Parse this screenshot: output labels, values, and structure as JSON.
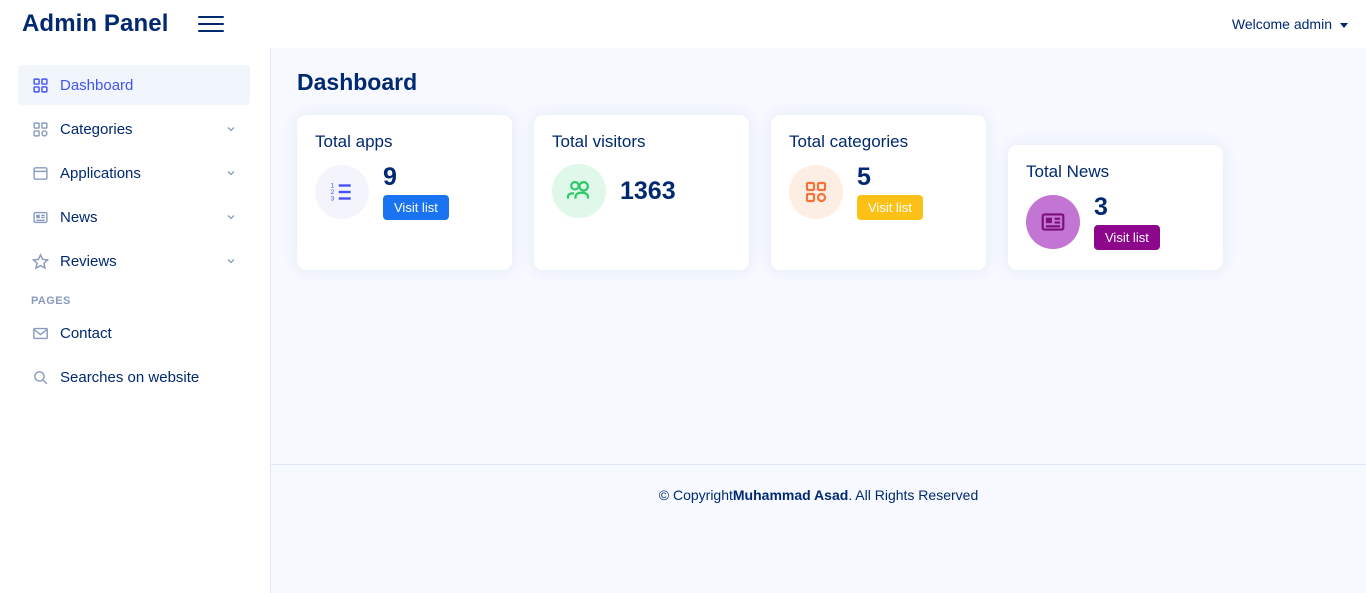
{
  "header": {
    "brand": "Admin Panel",
    "toggle_icon": "hamburger-menu-icon",
    "welcome_label": "Welcome admin",
    "caret_icon": "caret-down-icon"
  },
  "sidebar": {
    "items": [
      {
        "label": "Dashboard",
        "icon": "grid-icon",
        "active": true,
        "has_chevron": false
      },
      {
        "label": "Categories",
        "icon": "grid-icon",
        "active": false,
        "has_chevron": true
      },
      {
        "label": "Applications",
        "icon": "window-icon",
        "active": false,
        "has_chevron": true
      },
      {
        "label": "News",
        "icon": "news-icon",
        "active": false,
        "has_chevron": true
      },
      {
        "label": "Reviews",
        "icon": "star-icon",
        "active": false,
        "has_chevron": true
      }
    ],
    "section_heading": "PAGES",
    "page_items": [
      {
        "label": "Contact",
        "icon": "envelope-icon"
      },
      {
        "label": "Searches on website",
        "icon": "search-icon"
      }
    ]
  },
  "main": {
    "page_title": "Dashboard",
    "cards": [
      {
        "title": "Total apps",
        "value": "9",
        "icon": "numbered-list-icon",
        "icon_color": "#4154f1",
        "circle_color": "#f4f4fd",
        "button_label": "Visit list",
        "button_color": "#1a73f0",
        "has_button": true
      },
      {
        "title": "Total visitors",
        "value": "1363",
        "icon": "people-icon",
        "icon_color": "#2eca6a",
        "circle_color": "#e0f8e9",
        "button_label": "",
        "button_color": "",
        "has_button": false
      },
      {
        "title": "Total categories",
        "value": "5",
        "icon": "app-grid-icon",
        "icon_color": "#f3743b",
        "circle_color": "#fdeee4",
        "button_label": "Visit list",
        "button_color": "#fcc016",
        "has_button": true
      },
      {
        "title": "Total News",
        "value": "3",
        "icon": "news-card-icon",
        "icon_color": "#7d0f7d",
        "circle_color": "#c275d3",
        "button_label": "Visit list",
        "button_color": "#8d078d",
        "has_button": true
      }
    ]
  },
  "footer": {
    "prefix": "© Copyright ",
    "name": "Muhammad Asad",
    "suffix": ". All Rights Reserved"
  },
  "colors": {
    "brand_navy": "#012970",
    "accent_indigo": "#4154f1",
    "content_bg": "#f6f9ff"
  }
}
